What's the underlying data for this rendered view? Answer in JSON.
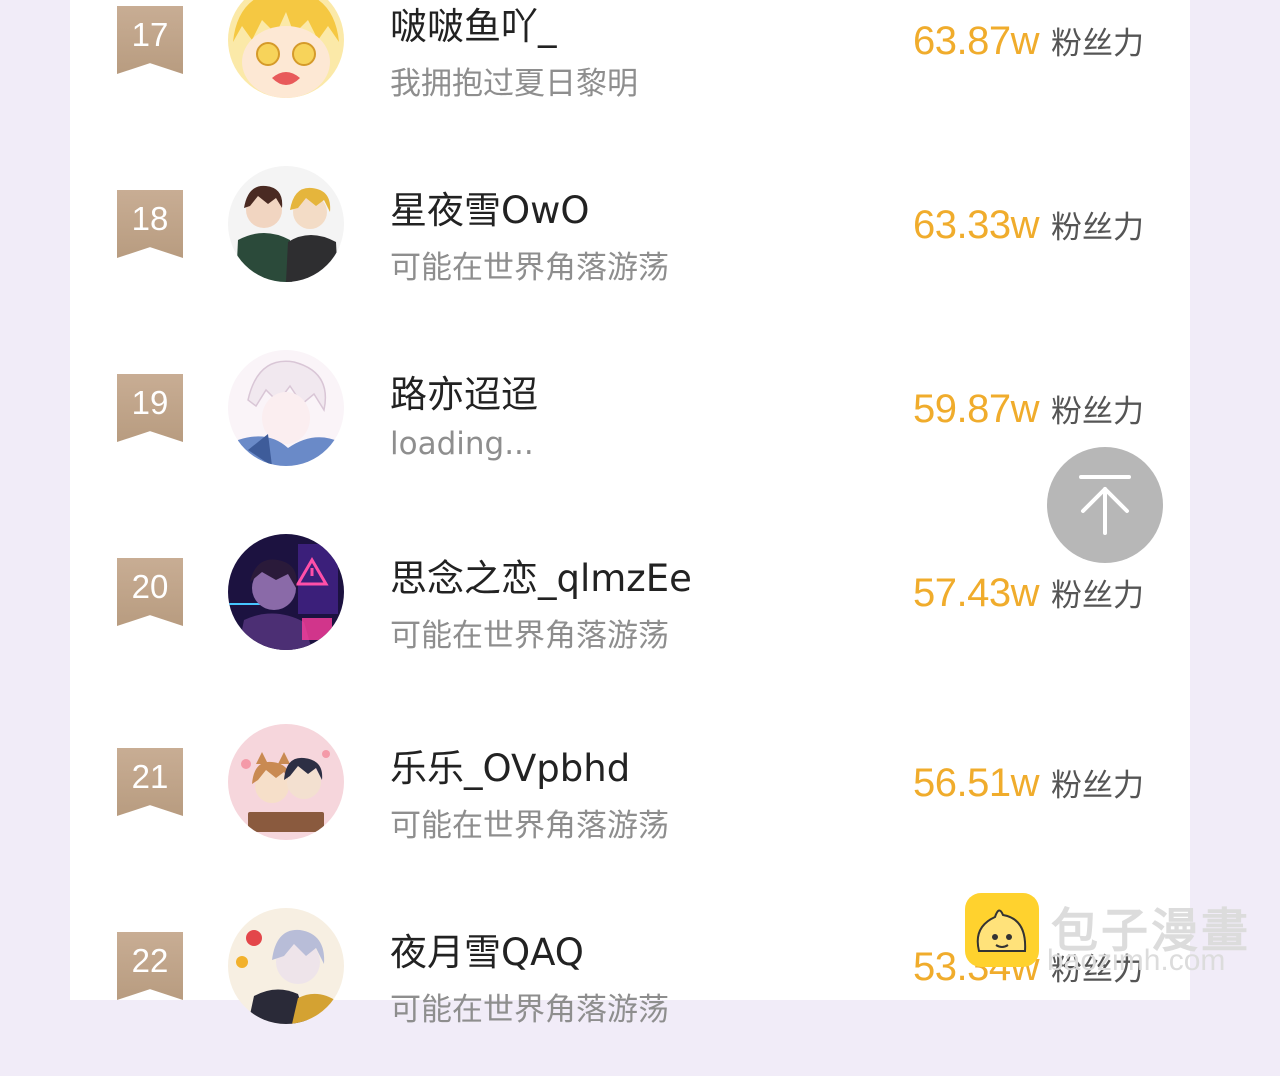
{
  "colors": {
    "accent": "#f0ac2c",
    "rank_badge": "#bfa388",
    "page_bg": "#f1ecf8"
  },
  "rows": [
    {
      "rank": "17",
      "name": "啵啵鱼吖_",
      "status": "我拥抱过夏日黎明",
      "value": "63.87w",
      "unit": "粉丝力"
    },
    {
      "rank": "18",
      "name": "星夜雪OwO",
      "status": "可能在世界角落游荡",
      "value": "63.33w",
      "unit": "粉丝力"
    },
    {
      "rank": "19",
      "name": "路亦迢迢",
      "status": "loading...",
      "value": "59.87w",
      "unit": "粉丝力"
    },
    {
      "rank": "20",
      "name": "思念之恋_qlmzEe",
      "status": "可能在世界角落游荡",
      "value": "57.43w",
      "unit": "粉丝力"
    },
    {
      "rank": "21",
      "name": "乐乐_OVpbhd",
      "status": "可能在世界角落游荡",
      "value": "56.51w",
      "unit": "粉丝力"
    },
    {
      "rank": "22",
      "name": "夜月雪QAQ",
      "status": "可能在世界角落游荡",
      "value": "53.34w",
      "unit": "粉丝力"
    }
  ],
  "back_to_top": {
    "icon": "arrow-up-icon"
  },
  "watermark": {
    "text": "包子漫畫",
    "url": "baozimh.com",
    "icon": "bun-logo-icon"
  }
}
